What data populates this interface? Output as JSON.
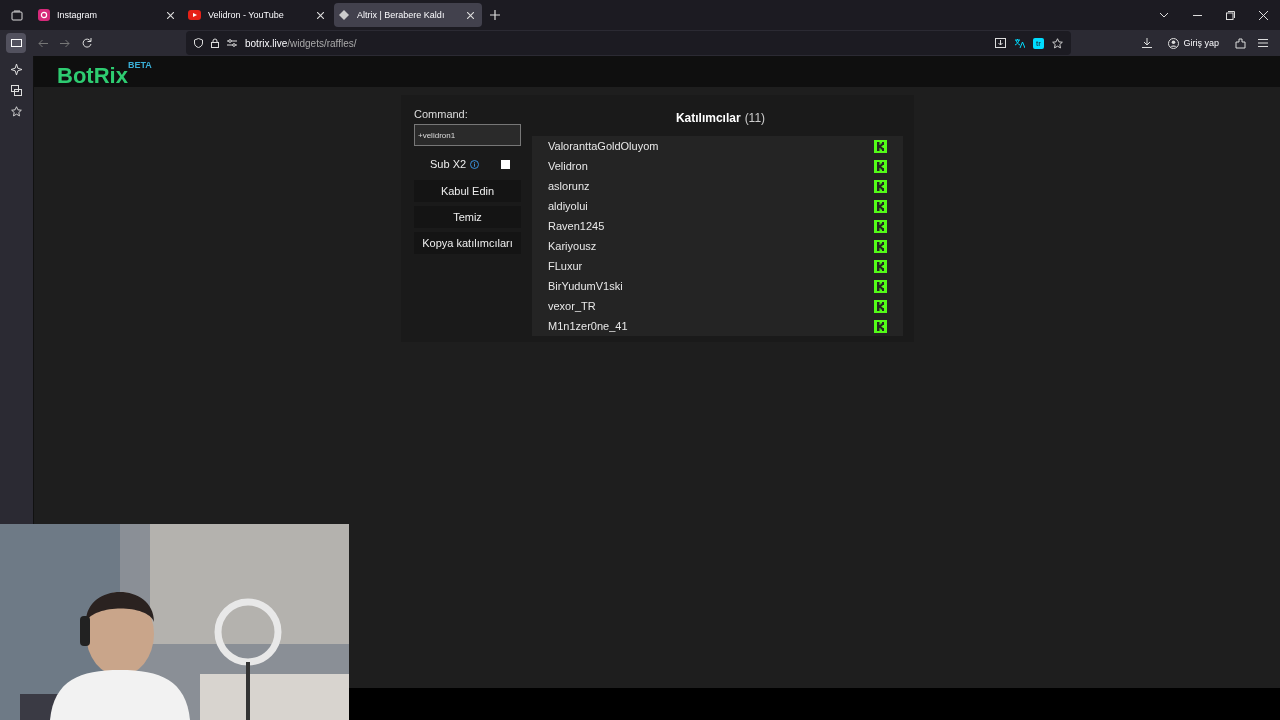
{
  "browser": {
    "tabs": [
      {
        "title": "Instagram",
        "selected": false
      },
      {
        "title": "Velidron - YouTube",
        "selected": false
      },
      {
        "title": "Altrix | Berabere Kaldı",
        "selected": true
      }
    ],
    "url_host": "botrix.live",
    "url_path": "/widgets/raffles/",
    "translate_badge": "tr",
    "sign_in": "Giriş yap"
  },
  "site": {
    "logo": "BotRix",
    "logo_badge": "BETA"
  },
  "raffle": {
    "command_label": "Command:",
    "command_value": "+velidron1",
    "sub_label": "Sub X2",
    "sub_checked": false,
    "buttons": [
      "Kabul Edin",
      "Temiz",
      "Kopya katılımcıları"
    ],
    "title": "Katılımcılar",
    "count": "(11)",
    "participants": [
      {
        "name": "ValoranttaGoldOluyom"
      },
      {
        "name": "Velidron"
      },
      {
        "name": "aslorunz"
      },
      {
        "name": "aldiyolui"
      },
      {
        "name": "Raven1245"
      },
      {
        "name": "Kariyousz"
      },
      {
        "name": "FLuxur"
      },
      {
        "name": "BirYudumV1ski"
      },
      {
        "name": "vexor_TR"
      },
      {
        "name": "M1n1zer0ne_41"
      }
    ]
  }
}
